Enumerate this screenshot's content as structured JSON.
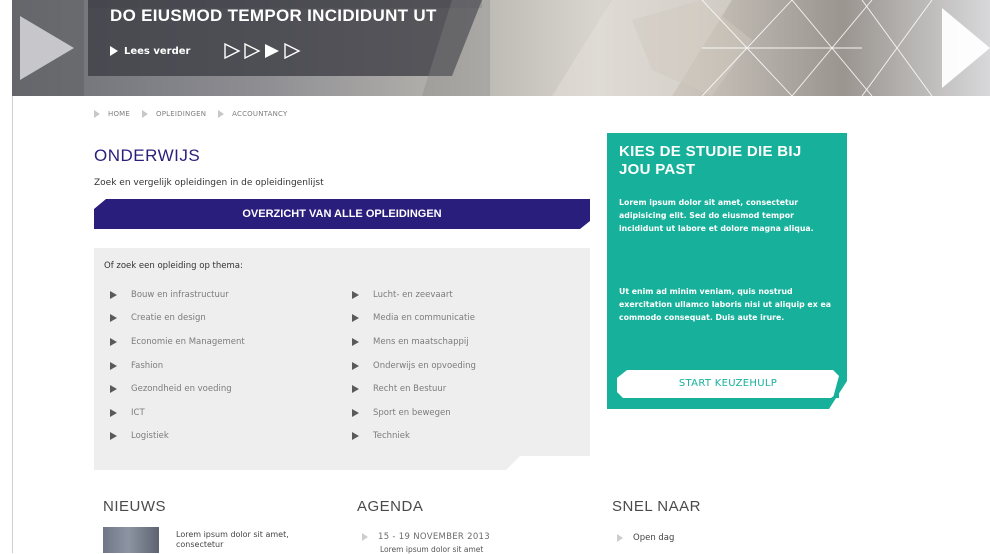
{
  "hero": {
    "title": "DO EIUSMOD TEMPOR INCIDIDUNT UT",
    "cta_label": "Lees verder"
  },
  "breadcrumb": [
    "HOME",
    "OPLEIDINGEN",
    "ACCOUNTANCY"
  ],
  "onderwijs": {
    "title": "ONDERWIJS",
    "intro": "Zoek en vergelijk opleidingen in de opleidingenlijst",
    "overview_button": "OVERZICHT VAN ALLE OPLEIDINGEN",
    "theme_heading": "Of zoek een opleiding op thema:",
    "themes_left": [
      "Bouw en infrastructuur",
      "Creatie en design",
      "Economie en Management",
      "Fashion",
      "Gezondheid en voeding",
      "ICT",
      "Logistiek"
    ],
    "themes_right": [
      "Lucht- en zeevaart",
      "Media en communicatie",
      "Mens en maatschappij",
      "Onderwijs en opvoeding",
      "Recht en Bestuur",
      "Sport en bewegen",
      "Techniek"
    ]
  },
  "keuze": {
    "title": "KIES DE STUDIE DIE BIJ JOU PAST",
    "para1": "Lorem ipsum dolor sit amet, consectetur adipisicing elit. Sed do eiusmod tempor incididunt ut labore et dolore magna aliqua.",
    "para2": "Ut enim ad minim veniam, quis nostrud exercitation ullamco laboris nisi ut aliquip ex ea commodo consequat. Duis aute irure.",
    "button": "START KEUZEHULP"
  },
  "nieuws": {
    "title": "NIEUWS",
    "item_text": "Lorem ipsum dolor sit amet, consectetur"
  },
  "agenda": {
    "title": "AGENDA",
    "date": "15 - 19 NOVEMBER 2013",
    "sub": "Lorem ipsum dolor sit amet"
  },
  "snel": {
    "title": "SNEL NAAR",
    "link": "Open dag"
  },
  "colors": {
    "primary": "#2a1e7c",
    "accent": "#17b19b",
    "panel": "#eeeeee"
  }
}
